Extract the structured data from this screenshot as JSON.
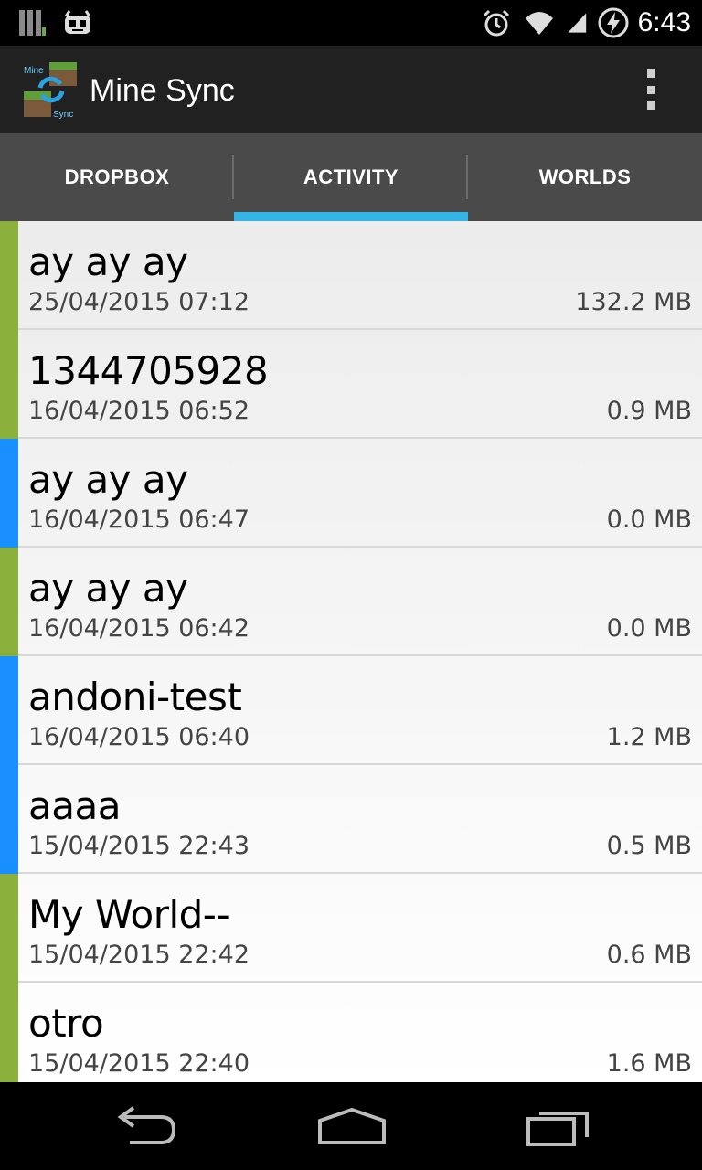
{
  "status_bar": {
    "time": "6:43",
    "icons": [
      "signal-bars-icon",
      "android-robot-icon",
      "alarm-icon",
      "wifi-icon",
      "cell-signal-icon",
      "battery-charging-icon"
    ]
  },
  "action_bar": {
    "app_icon_label_top": "Mine",
    "app_icon_label_bottom": "Sync",
    "title": "Mine Sync",
    "overflow_icon": "overflow-menu-icon"
  },
  "tabs": [
    {
      "label": "DROPBOX",
      "selected": false
    },
    {
      "label": "ACTIVITY",
      "selected": true
    },
    {
      "label": "WORLDS",
      "selected": false
    }
  ],
  "colors": {
    "green": "#8bb13c",
    "blue": "#1a8fff",
    "tab_indicator": "#33b5e5"
  },
  "items": [
    {
      "name": "ay ay ay",
      "date": "25/04/2015 07:12",
      "size": "132.2 MB",
      "status": "green"
    },
    {
      "name": "1344705928",
      "date": "16/04/2015 06:52",
      "size": "0.9 MB",
      "status": "green"
    },
    {
      "name": "ay ay ay",
      "date": "16/04/2015 06:47",
      "size": "0.0 MB",
      "status": "blue"
    },
    {
      "name": "ay ay ay",
      "date": "16/04/2015 06:42",
      "size": "0.0 MB",
      "status": "green"
    },
    {
      "name": "andoni-test",
      "date": "16/04/2015 06:40",
      "size": "1.2 MB",
      "status": "blue"
    },
    {
      "name": "aaaa",
      "date": "15/04/2015 22:43",
      "size": "0.5 MB",
      "status": "blue"
    },
    {
      "name": "My World--",
      "date": "15/04/2015 22:42",
      "size": "0.6 MB",
      "status": "green"
    },
    {
      "name": "otro",
      "date": "15/04/2015 22:40",
      "size": "1.6 MB",
      "status": "green"
    }
  ],
  "nav_bar": {
    "buttons": [
      "back-icon",
      "home-icon",
      "recents-icon"
    ]
  }
}
